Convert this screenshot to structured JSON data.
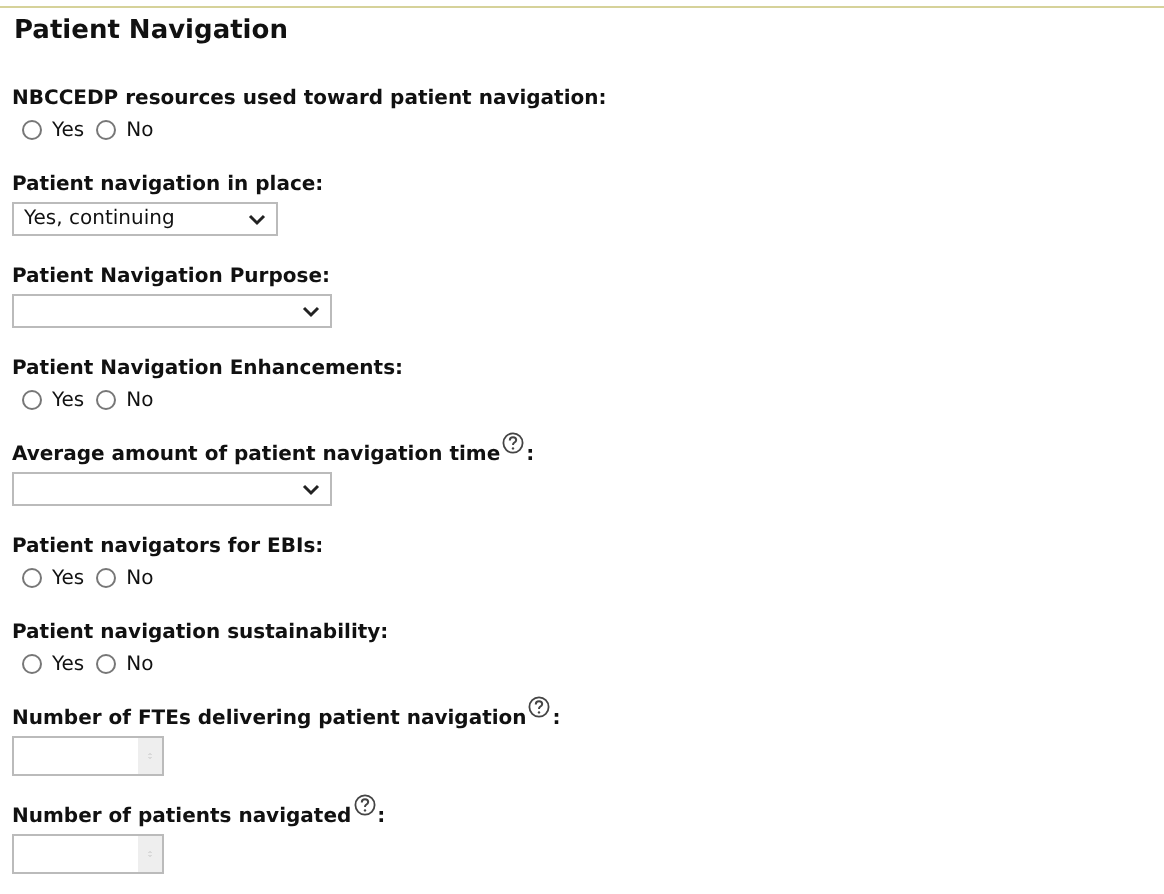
{
  "section": {
    "title": "Patient Navigation"
  },
  "fields": [
    {
      "kind": "radio",
      "label": "NBCCEDP resources used toward patient navigation:",
      "help": false,
      "options": [
        {
          "label": "Yes",
          "selected": false
        },
        {
          "label": "No",
          "selected": false
        }
      ]
    },
    {
      "kind": "select",
      "label": "Patient navigation in place:",
      "help": false,
      "value": "Yes, continuing"
    },
    {
      "kind": "select",
      "label": "Patient Navigation Purpose:",
      "help": false
    },
    {
      "kind": "radio",
      "label": "Patient Navigation Enhancements:",
      "help": false,
      "options": [
        {
          "label": "Yes",
          "selected": false
        },
        {
          "label": "No",
          "selected": false
        }
      ]
    },
    {
      "kind": "select",
      "label": "Average amount of patient navigation time",
      "help": true
    },
    {
      "kind": "radio",
      "label": "Patient navigators for EBIs:",
      "help": false,
      "options": [
        {
          "label": "Yes",
          "selected": false
        },
        {
          "label": "No",
          "selected": false
        }
      ]
    },
    {
      "kind": "radio",
      "label": "Patient navigation sustainability:",
      "help": false,
      "options": [
        {
          "label": "Yes",
          "selected": false
        },
        {
          "label": "No",
          "selected": false
        }
      ]
    },
    {
      "kind": "number",
      "label": "Number of FTEs delivering patient navigation",
      "help": true
    },
    {
      "kind": "number",
      "label": "Number of patients navigated",
      "help": true
    }
  ],
  "colon": ":"
}
